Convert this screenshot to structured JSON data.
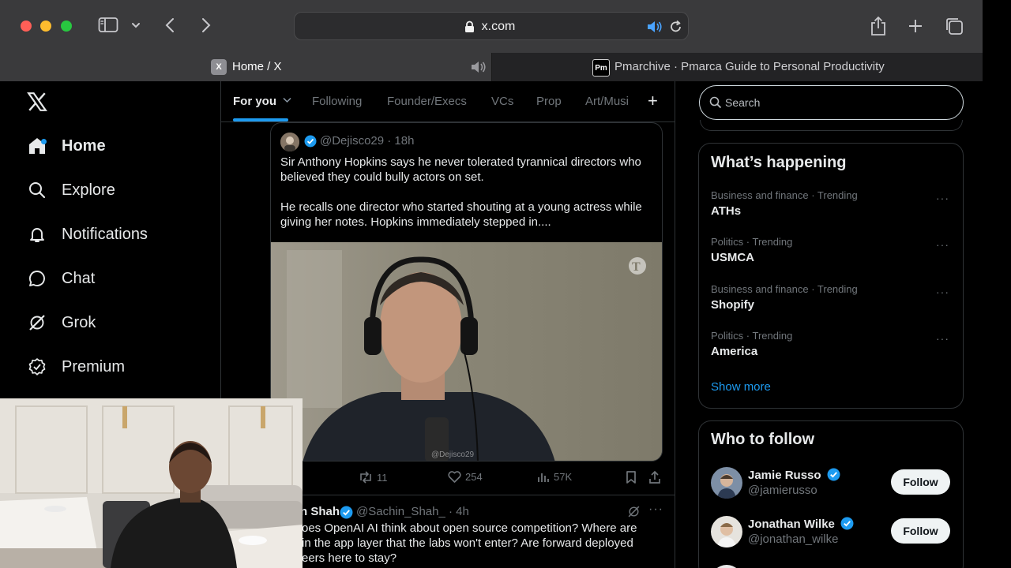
{
  "browser": {
    "url": "x.com",
    "tabs": [
      {
        "favicon": "X",
        "title": "Home / X"
      },
      {
        "favicon": "Pm",
        "title": "Pmarchive · Pmarca Guide to Personal Productivity"
      }
    ]
  },
  "sidebar": {
    "items": [
      {
        "label": "Home",
        "icon": "home-icon"
      },
      {
        "label": "Explore",
        "icon": "search-icon"
      },
      {
        "label": "Notifications",
        "icon": "bell-icon"
      },
      {
        "label": "Chat",
        "icon": "chat-icon"
      },
      {
        "label": "Grok",
        "icon": "grok-icon"
      },
      {
        "label": "Premium",
        "icon": "premium-icon"
      }
    ]
  },
  "feed": {
    "tabs": [
      "For you",
      "Following",
      "Founder/Execs",
      "VCs",
      "Prop",
      "Art/Musi"
    ],
    "quoted": {
      "handle": "@Dejisco29 · 18h",
      "paragraphs": [
        "Sir Anthony Hopkins says he never tolerated tyrannical directors who believed they could bully actors on set.",
        "He recalls one director who started shouting at a young actress while giving her notes. Hopkins immediately stepped in...."
      ],
      "watermark": "@Dejisco29"
    },
    "actions": {
      "retweets": "11",
      "likes": "254",
      "views": "57K"
    },
    "next_tweet": {
      "name": "n Shah",
      "handle": "@Sachin_Shah_ · 4h",
      "text": "oes OpenAI AI think about open source competition? Where are in the app layer that the labs won't enter? Are forward deployed eers here to stay?"
    }
  },
  "right": {
    "search_placeholder": "Search",
    "trending_title": "What’s happening",
    "trends": [
      {
        "meta": "Business and finance · Trending",
        "name": "ATHs"
      },
      {
        "meta": "Politics · Trending",
        "name": "USMCA"
      },
      {
        "meta": "Business and finance · Trending",
        "name": "Shopify"
      },
      {
        "meta": "Politics · Trending",
        "name": "America"
      }
    ],
    "show_more": "Show more",
    "who_to_follow_title": "Who to follow",
    "follow_suggestions": [
      {
        "name": "Jamie Russo",
        "handle": "@jamierusso",
        "button": "Follow"
      },
      {
        "name": "Jonathan Wilke",
        "handle": "@jonathan_wilke",
        "button": "Follow"
      }
    ]
  },
  "colors": {
    "accent": "#1d9bf0",
    "background": "#000000",
    "border": "#2f3336",
    "muted": "#71767b"
  }
}
